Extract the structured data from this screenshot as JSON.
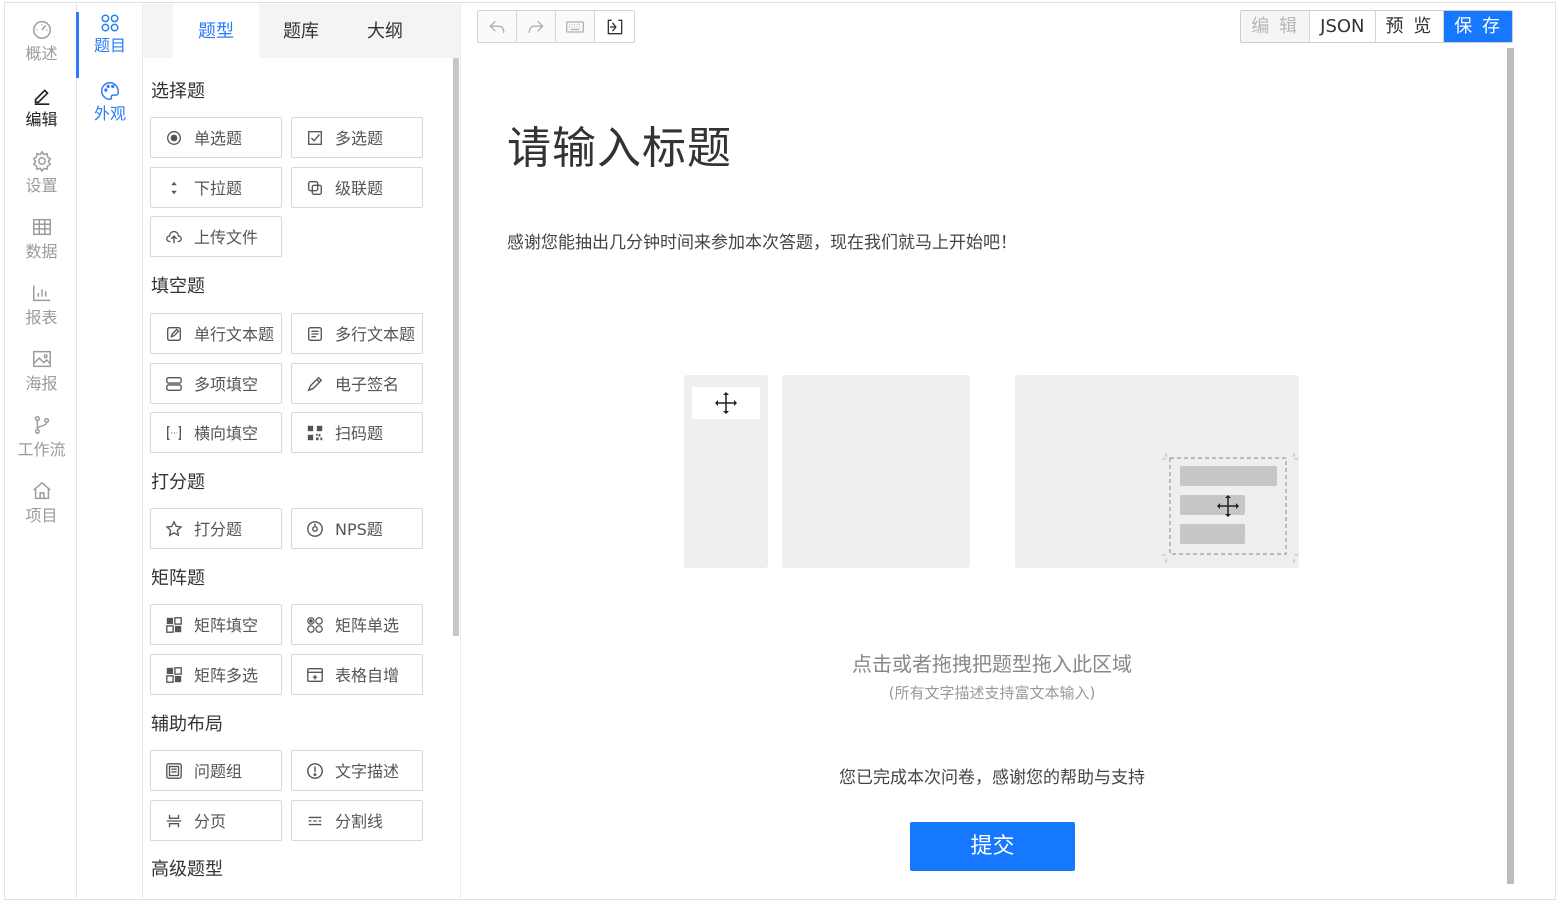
{
  "leftnav": {
    "items": [
      {
        "label": "概述",
        "icon": "dashboard-icon"
      },
      {
        "label": "编辑",
        "icon": "pen-icon",
        "active": true
      },
      {
        "label": "设置",
        "icon": "gear-icon"
      },
      {
        "label": "数据",
        "icon": "table-icon"
      },
      {
        "label": "报表",
        "icon": "bar-chart-icon"
      },
      {
        "label": "海报",
        "icon": "image-icon"
      },
      {
        "label": "工作流",
        "icon": "branch-icon"
      },
      {
        "label": "项目",
        "icon": "home-icon"
      }
    ]
  },
  "subnav": {
    "items": [
      {
        "label": "题目",
        "icon": "grid-circles-icon",
        "active": true
      },
      {
        "label": "外观",
        "icon": "palette-icon"
      }
    ]
  },
  "tabs": [
    "题型",
    "题库",
    "大纲"
  ],
  "groups": [
    {
      "title": "选择题",
      "items": [
        {
          "label": "单选题",
          "icon": "radio-icon"
        },
        {
          "label": "多选题",
          "icon": "checkbox-icon"
        },
        {
          "label": "下拉题",
          "icon": "dropdown-icon"
        },
        {
          "label": "级联题",
          "icon": "cascade-icon"
        },
        {
          "label": "上传文件",
          "icon": "upload-icon"
        }
      ]
    },
    {
      "title": "填空题",
      "items": [
        {
          "label": "单行文本题",
          "icon": "edit-icon"
        },
        {
          "label": "多行文本题",
          "icon": "textarea-icon"
        },
        {
          "label": "多项填空",
          "icon": "multi-fill-icon"
        },
        {
          "label": "电子签名",
          "icon": "signature-icon"
        },
        {
          "label": "横向填空",
          "icon": "bracket-icon"
        },
        {
          "label": "扫码题",
          "icon": "barcode-icon"
        }
      ]
    },
    {
      "title": "打分题",
      "items": [
        {
          "label": "打分题",
          "icon": "star-icon"
        },
        {
          "label": "NPS题",
          "icon": "nps-icon"
        }
      ]
    },
    {
      "title": "矩阵题",
      "items": [
        {
          "label": "矩阵填空",
          "icon": "matrix-fill-icon"
        },
        {
          "label": "矩阵单选",
          "icon": "matrix-radio-icon"
        },
        {
          "label": "矩阵多选",
          "icon": "matrix-check-icon"
        },
        {
          "label": "表格自增",
          "icon": "table-add-icon"
        }
      ]
    },
    {
      "title": "辅助布局",
      "items": [
        {
          "label": "问题组",
          "icon": "group-icon"
        },
        {
          "label": "文字描述",
          "icon": "info-icon"
        },
        {
          "label": "分页",
          "icon": "pagebreak-icon"
        },
        {
          "label": "分割线",
          "icon": "divider-icon"
        }
      ]
    },
    {
      "title": "高级题型",
      "items": []
    }
  ],
  "toolbar": {
    "tools": [
      "undo-icon",
      "redo-icon",
      "keyboard-icon",
      "import-icon"
    ]
  },
  "actions": {
    "edit": "编 辑",
    "json": "JSON",
    "preview": "预 览",
    "save": "保 存"
  },
  "survey": {
    "title": "请输入标题",
    "description": "感谢您能抽出几分钟时间来参加本次答题，现在我们就马上开始吧！",
    "drop_hint": "点击或者拖拽把题型拖入此区域",
    "drop_sub": "(所有文字描述支持富文本输入)",
    "end_text": "您已完成本次问卷，感谢您的帮助与支持",
    "submit": "提交"
  }
}
